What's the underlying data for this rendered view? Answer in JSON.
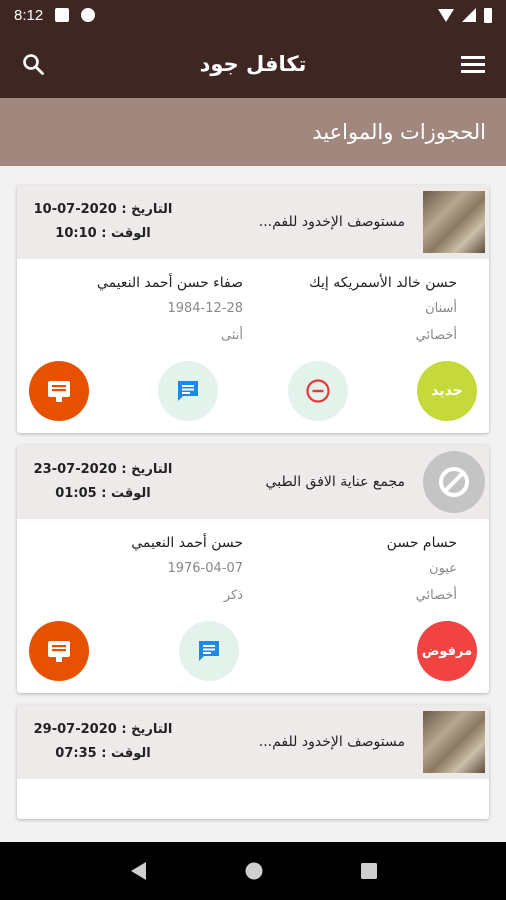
{
  "status_bar": {
    "time": "8:12"
  },
  "app_bar": {
    "title": "تكافل جود"
  },
  "section": {
    "title": "الحجوزات والمواعيد"
  },
  "colors": {
    "primary_dark": "#3e2723",
    "section_bg": "#a1887f",
    "new": "#c6d93b",
    "rejected": "#f04342",
    "invoice": "#e65100",
    "chat_icon": "#1e88e5",
    "cancel_icon": "#e53935"
  },
  "bookings": [
    {
      "hospital": "مستوصف الإخدود للفم...",
      "date": "التاريخ : 2020-07-10",
      "time": "الوقت : 10:10",
      "patient": {
        "name": "صفاء حسن أحمد النعيمي",
        "birth": "1984-12-28",
        "gender": "أنثى"
      },
      "doctor": {
        "name": "حسن خالد الأسمريكه إيك",
        "specialty": "أسنان",
        "rank": "أخصائي"
      },
      "status": "جديد"
    },
    {
      "hospital": "مجمع عناية الافق الطبي",
      "date": "التاريخ : 2020-07-23",
      "time": "الوقت : 01:05",
      "patient": {
        "name": "حسن أحمد النعيمي",
        "birth": "1976-04-07",
        "gender": "ذكر"
      },
      "doctor": {
        "name": "حسام حسن",
        "specialty": "عيون",
        "rank": "أخصائي"
      },
      "status": "مرفوض"
    },
    {
      "hospital": "مستوصف الإخدود للفم...",
      "date": "التاريخ : 2020-07-29",
      "time": "الوقت : 07:35"
    }
  ]
}
